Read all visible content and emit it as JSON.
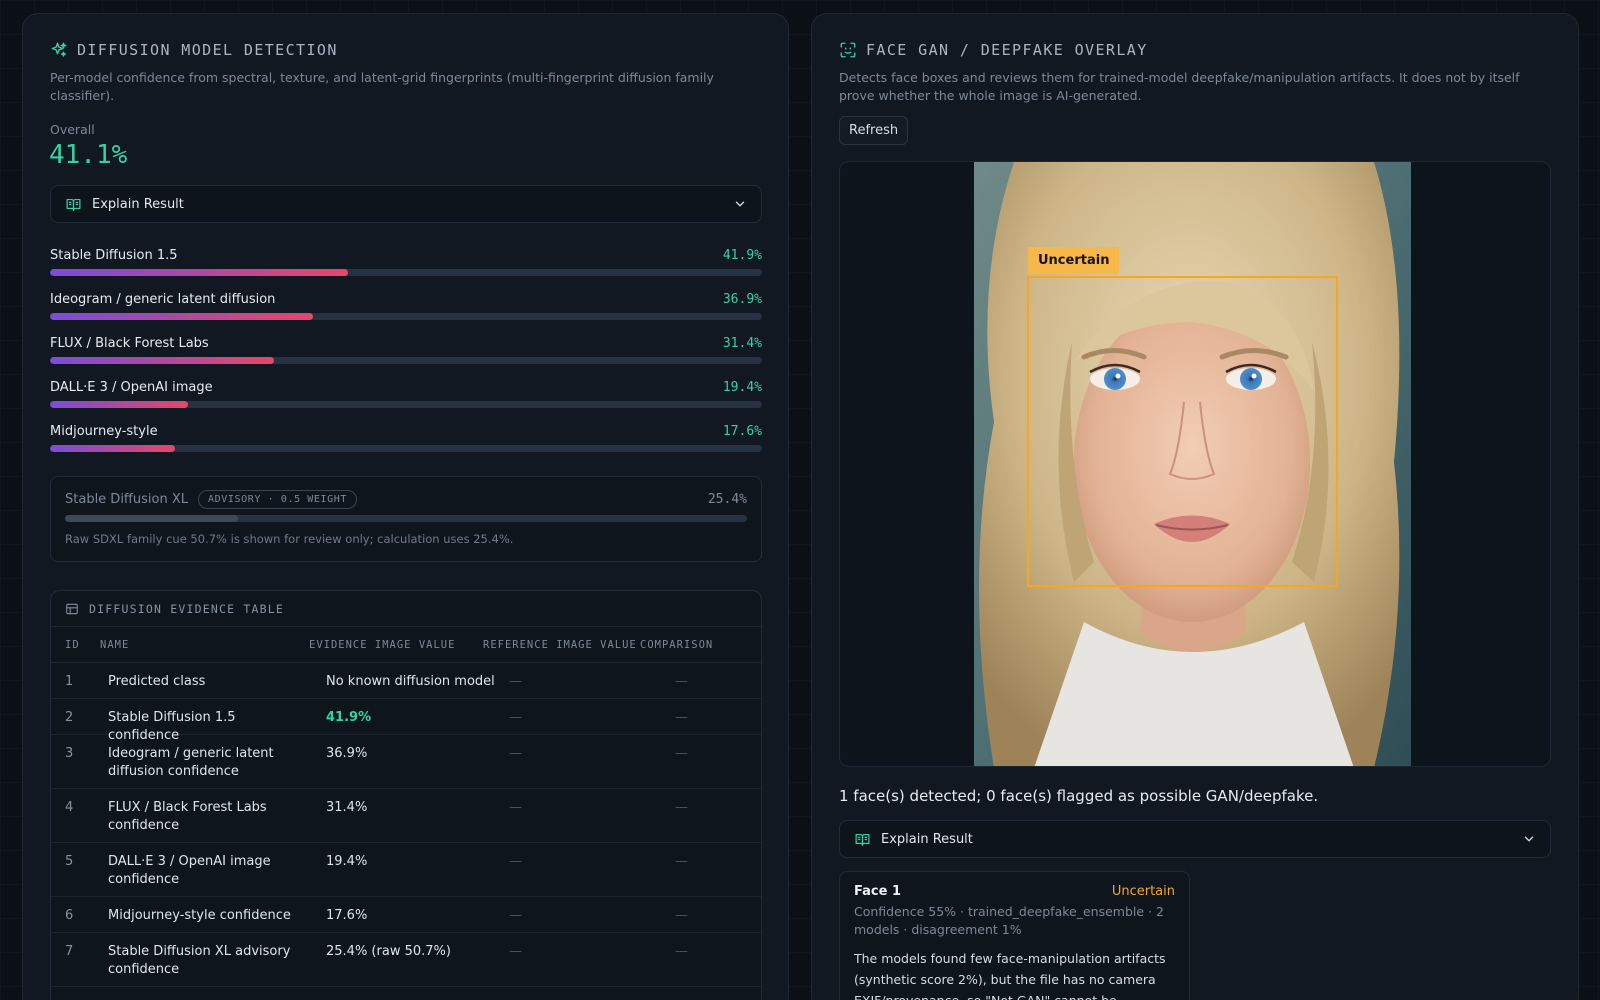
{
  "colors": {
    "accent": "#33d4a4",
    "warning": "#f5a623",
    "panel": "#111822",
    "background": "#0b1017"
  },
  "diffusion": {
    "icon": "sparkles-icon",
    "title": "DIFFUSION MODEL DETECTION",
    "description": "Per-model confidence from spectral, texture, and latent-grid fingerprints (multi-fingerprint diffusion family classifier).",
    "overall_label": "Overall",
    "overall_value": "41.1%",
    "explain_label": "Explain Result",
    "models": [
      {
        "name": "Stable Diffusion 1.5",
        "value_text": "41.9%",
        "fraction": 0.419
      },
      {
        "name": "Ideogram / generic latent diffusion",
        "value_text": "36.9%",
        "fraction": 0.369
      },
      {
        "name": "FLUX / Black Forest Labs",
        "value_text": "31.4%",
        "fraction": 0.314
      },
      {
        "name": "DALL·E 3 / OpenAI image",
        "value_text": "19.4%",
        "fraction": 0.194
      },
      {
        "name": "Midjourney-style",
        "value_text": "17.6%",
        "fraction": 0.176
      }
    ],
    "advisory": {
      "name": "Stable Diffusion XL",
      "badge": "ADVISORY · 0.5 WEIGHT",
      "value_text": "25.4%",
      "fraction": 0.254,
      "note": "Raw SDXL family cue 50.7% is shown for review only; calculation uses 25.4%."
    },
    "evidence": {
      "title": "DIFFUSION EVIDENCE TABLE",
      "columns": [
        "ID",
        "NAME",
        "EVIDENCE IMAGE VALUE",
        "REFERENCE IMAGE VALUE",
        "COMPARISON"
      ],
      "rows": [
        {
          "id": "1",
          "name": "Predicted class",
          "value": "No known diffusion model",
          "reference": "—",
          "comparison": "—"
        },
        {
          "id": "2",
          "name": "Stable Diffusion 1.5 confidence",
          "value": "41.9%",
          "reference": "—",
          "comparison": "—"
        },
        {
          "id": "3",
          "name": "Ideogram / generic latent diffusion confidence",
          "value": "36.9%",
          "reference": "—",
          "comparison": "—"
        },
        {
          "id": "4",
          "name": "FLUX / Black Forest Labs confidence",
          "value": "31.4%",
          "reference": "—",
          "comparison": "—"
        },
        {
          "id": "5",
          "name": "DALL·E 3 / OpenAI image confidence",
          "value": "19.4%",
          "reference": "—",
          "comparison": "—"
        },
        {
          "id": "6",
          "name": "Midjourney-style confidence",
          "value": "17.6%",
          "reference": "—",
          "comparison": "—"
        },
        {
          "id": "7",
          "name": "Stable Diffusion XL advisory confidence",
          "value": "25.4% (raw 50.7%)",
          "reference": "—",
          "comparison": "—"
        }
      ]
    }
  },
  "face": {
    "icon": "face-scan-icon",
    "title": "FACE GAN / DEEPFAKE OVERLAY",
    "description": "Detects face boxes and reviews them for trained-model deepfake/manipulation artifacts. It does not by itself prove whether the whole image is AI-generated.",
    "refresh_label": "Refresh",
    "box_label": "Uncertain",
    "summary": "1 face(s) detected; 0 face(s) flagged as possible GAN/deepfake.",
    "explain_label": "Explain Result",
    "card": {
      "title": "Face 1",
      "status": "Uncertain",
      "meta": "Confidence 55% · trained_deepfake_ensemble · 2 models · disagreement 1%",
      "text": "The models found few face-manipulation artifacts (synthetic score 2%), but the file has no camera EXIF/provenance, so \"Not GAN\" cannot be"
    }
  }
}
